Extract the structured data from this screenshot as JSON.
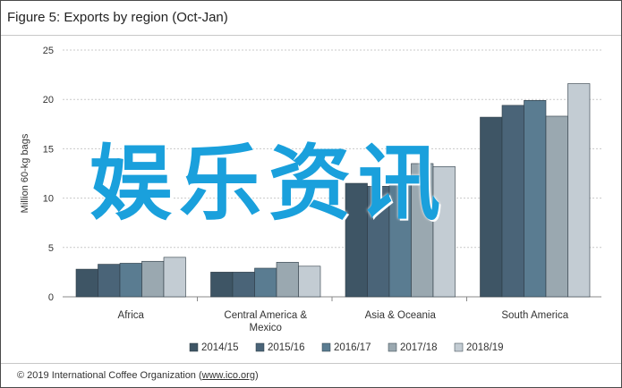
{
  "title": "Figure 5: Exports by region (Oct-Jan)",
  "footer": {
    "text_before": "© 2019 International Coffee Organization (",
    "link": "www.ico.org",
    "text_after": ")"
  },
  "watermark": "娱乐资讯",
  "chart_data": {
    "type": "bar",
    "title": "Figure 5: Exports by region (Oct-Jan)",
    "xlabel": "",
    "ylabel": "Million 60-kg bags",
    "ylim": [
      0,
      25
    ],
    "yticks": [
      0,
      5,
      10,
      15,
      20,
      25
    ],
    "grid": true,
    "legend_position": "bottom",
    "categories": [
      "Africa",
      "Central America & Mexico",
      "Asia & Oceania",
      "South America"
    ],
    "category_lines": [
      [
        "Africa"
      ],
      [
        "Central America &",
        "Mexico"
      ],
      [
        "Asia & Oceania"
      ],
      [
        "South America"
      ]
    ],
    "series": [
      {
        "name": "2014/15",
        "color": "#3e5565",
        "values": [
          2.8,
          2.5,
          11.5,
          18.2
        ]
      },
      {
        "name": "2015/16",
        "color": "#4a6478",
        "values": [
          3.3,
          2.5,
          11.2,
          19.4
        ]
      },
      {
        "name": "2016/17",
        "color": "#5a7c91",
        "values": [
          3.4,
          2.9,
          11.8,
          19.9
        ]
      },
      {
        "name": "2017/18",
        "color": "#9aa8b0",
        "values": [
          3.6,
          3.5,
          13.5,
          18.3
        ]
      },
      {
        "name": "2018/19",
        "color": "#c3ccd3",
        "values": [
          4.0,
          3.1,
          13.2,
          21.6
        ]
      }
    ]
  }
}
